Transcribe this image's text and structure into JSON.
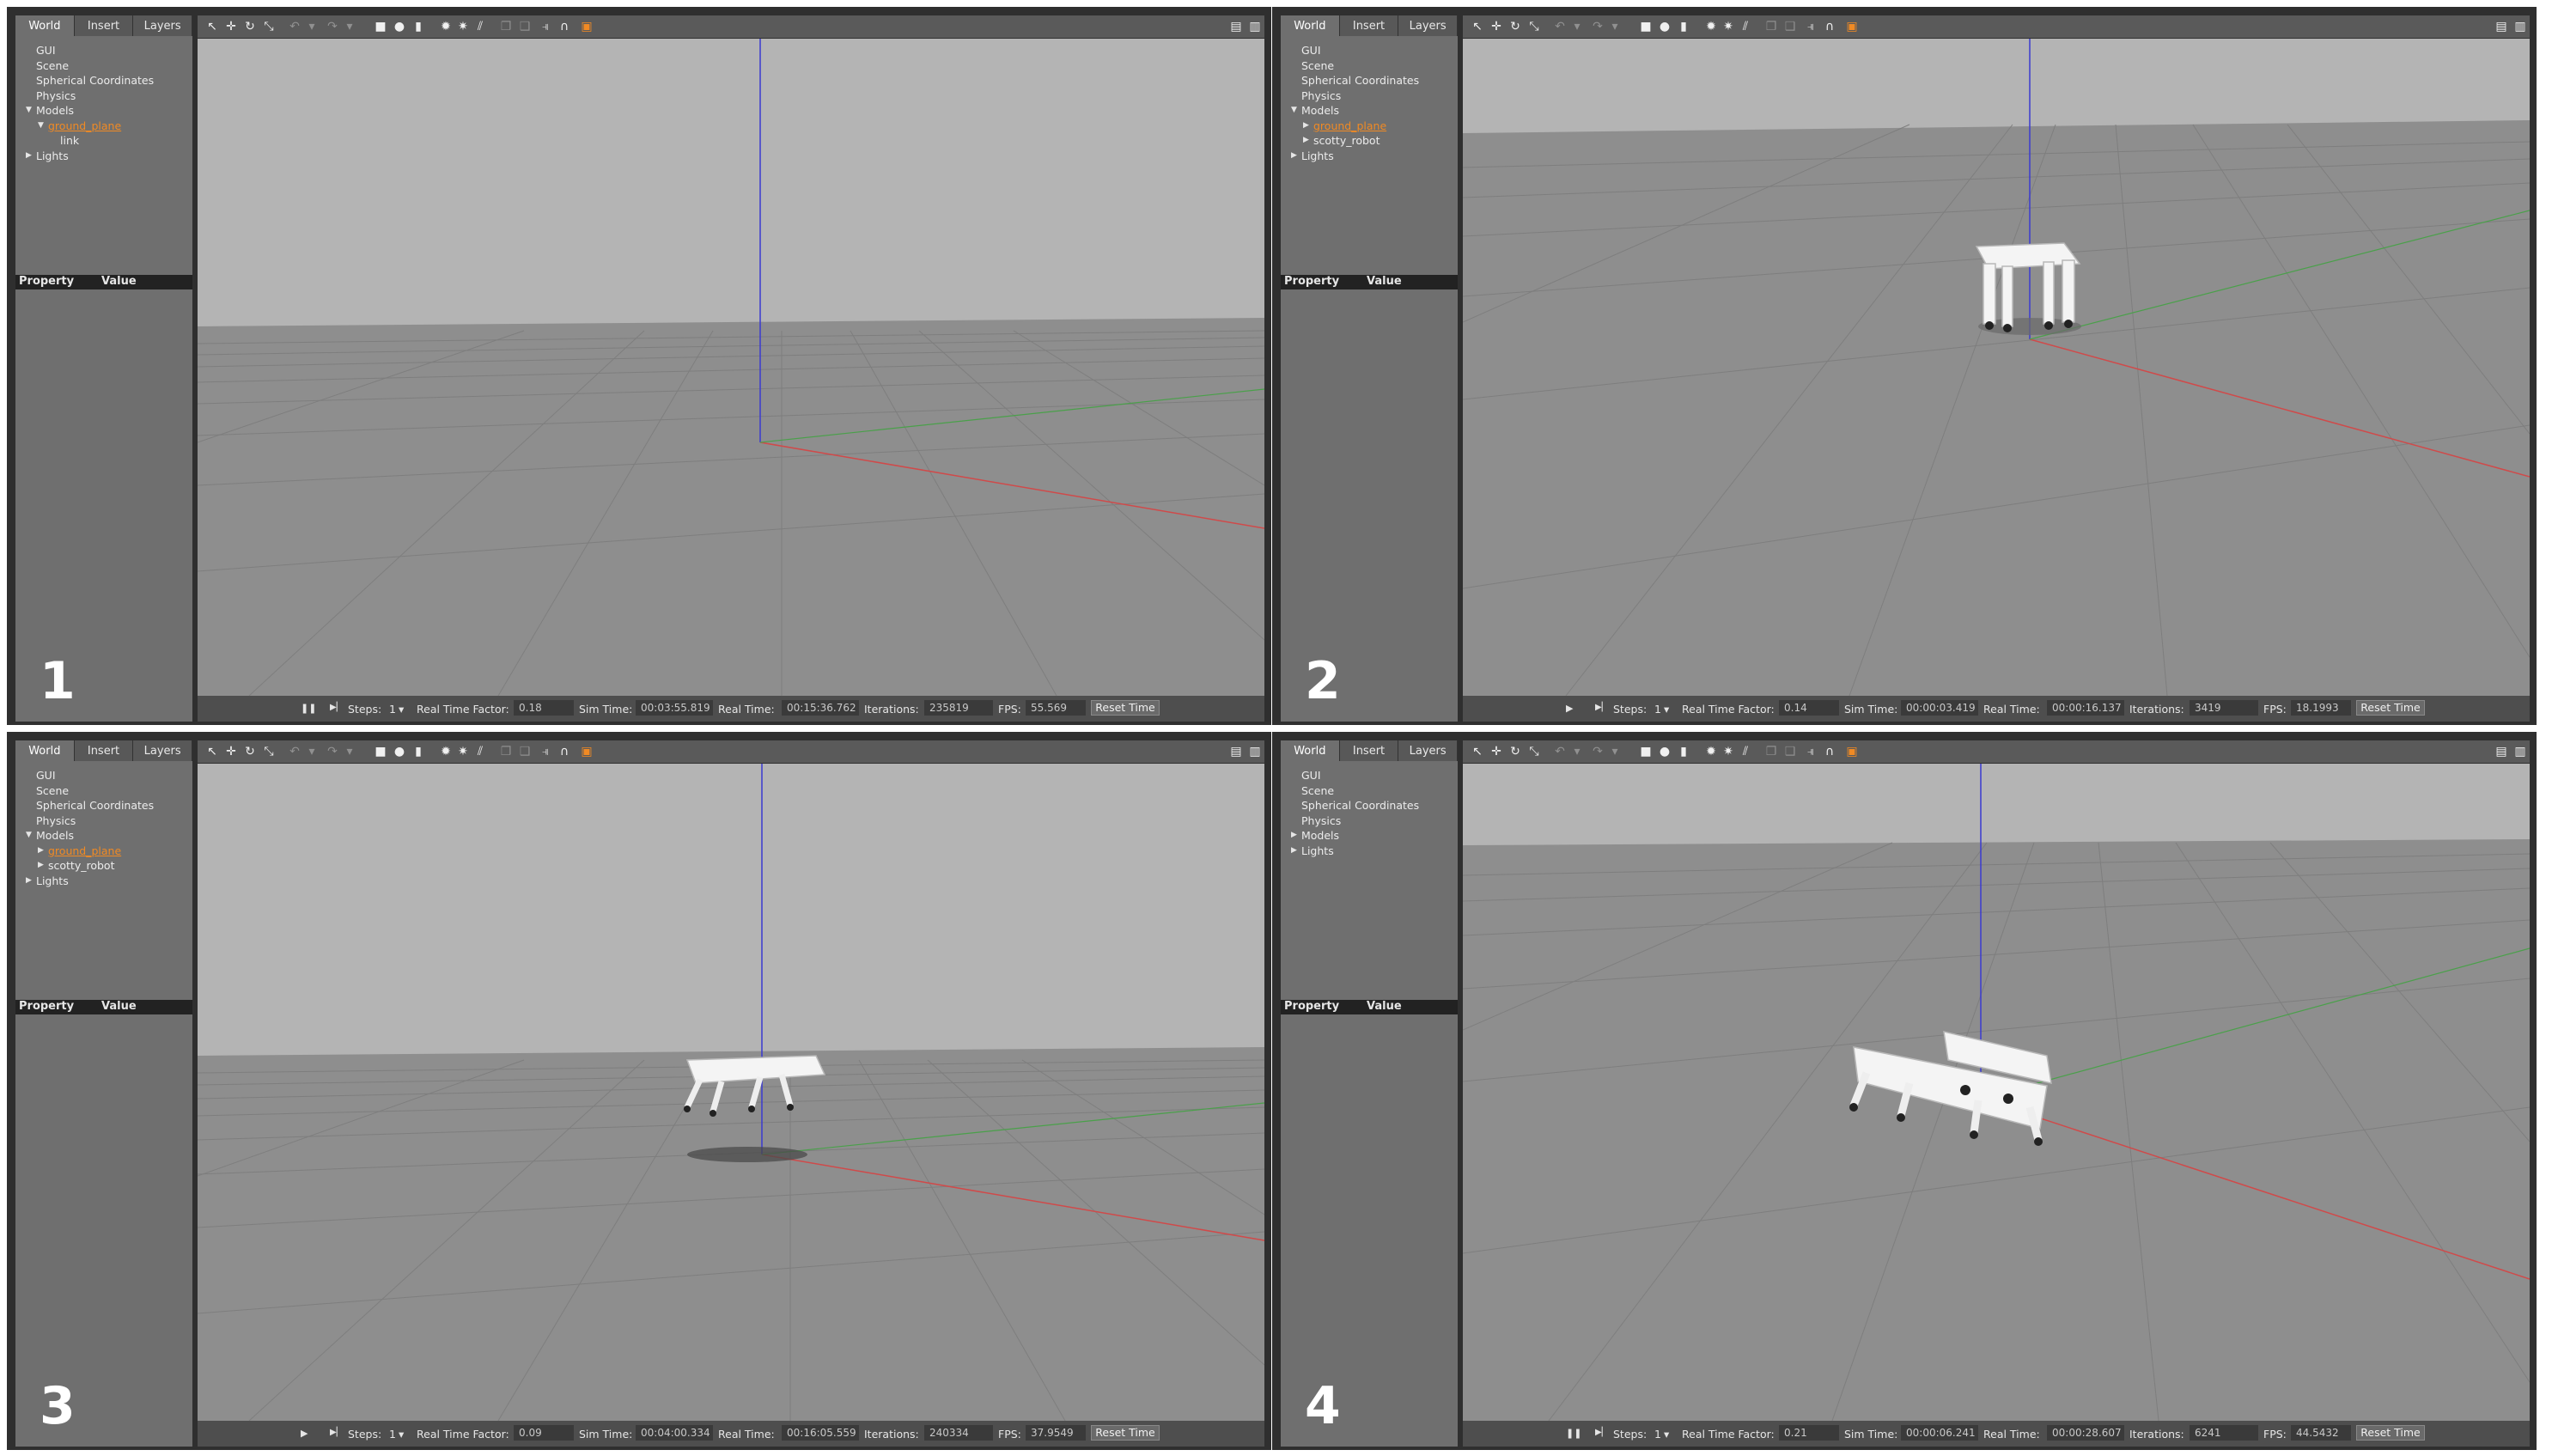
{
  "tabs": [
    "World",
    "Insert",
    "Layers"
  ],
  "property_header": {
    "property": "Property",
    "value": "Value"
  },
  "toolbar_icons": [
    "select-arrow-icon",
    "translate-icon",
    "rotate-icon",
    "scale-icon",
    "undo-icon",
    "undo-dropdown-icon",
    "redo-icon",
    "redo-dropdown-icon",
    "box-icon",
    "sphere-icon",
    "cylinder-icon",
    "point-light-icon",
    "spot-light-icon",
    "directional-light-icon",
    "copy-icon",
    "paste-icon",
    "align-icon",
    "snap-icon",
    "change-view-icon",
    "screenshot-icon",
    "record-icon"
  ],
  "panels": [
    {
      "number": "1",
      "tree": [
        {
          "label": "GUI",
          "indent": 0,
          "arrow": "",
          "highlight": false
        },
        {
          "label": "Scene",
          "indent": 0,
          "arrow": "",
          "highlight": false
        },
        {
          "label": "Spherical Coordinates",
          "indent": 0,
          "arrow": "",
          "highlight": false
        },
        {
          "label": "Physics",
          "indent": 0,
          "arrow": "",
          "highlight": false
        },
        {
          "label": "Models",
          "indent": 0,
          "arrow": "down",
          "highlight": false
        },
        {
          "label": "ground_plane",
          "indent": 1,
          "arrow": "down",
          "highlight": true
        },
        {
          "label": "link",
          "indent": 2,
          "arrow": "",
          "highlight": false
        },
        {
          "label": "Lights",
          "indent": 0,
          "arrow": "right",
          "highlight": false
        }
      ],
      "status": {
        "playing": true,
        "steps_label": "Steps:",
        "steps_value": "1",
        "rtf_label": "Real Time Factor:",
        "rtf_value": "0.18",
        "sim_label": "Sim Time:",
        "sim_value": "00:03:55.819",
        "real_label": "Real Time:",
        "real_value": "00:15:36.762",
        "iter_label": "Iterations:",
        "iter_value": "235819",
        "fps_label": "FPS:",
        "fps_value": "55.569",
        "reset_label": "Reset Time"
      }
    },
    {
      "number": "2",
      "tree": [
        {
          "label": "GUI",
          "indent": 0,
          "arrow": "",
          "highlight": false
        },
        {
          "label": "Scene",
          "indent": 0,
          "arrow": "",
          "highlight": false
        },
        {
          "label": "Spherical Coordinates",
          "indent": 0,
          "arrow": "",
          "highlight": false
        },
        {
          "label": "Physics",
          "indent": 0,
          "arrow": "",
          "highlight": false
        },
        {
          "label": "Models",
          "indent": 0,
          "arrow": "down",
          "highlight": false
        },
        {
          "label": "ground_plane",
          "indent": 1,
          "arrow": "right",
          "highlight": true
        },
        {
          "label": "scotty_robot",
          "indent": 1,
          "arrow": "right",
          "highlight": false
        },
        {
          "label": "Lights",
          "indent": 0,
          "arrow": "right",
          "highlight": false
        }
      ],
      "status": {
        "playing": false,
        "steps_label": "Steps:",
        "steps_value": "1",
        "rtf_label": "Real Time Factor:",
        "rtf_value": "0.14",
        "sim_label": "Sim Time:",
        "sim_value": "00:00:03.419",
        "real_label": "Real Time:",
        "real_value": "00:00:16.137",
        "iter_label": "Iterations:",
        "iter_value": "3419",
        "fps_label": "FPS:",
        "fps_value": "18.1993",
        "reset_label": "Reset Time"
      }
    },
    {
      "number": "3",
      "tree": [
        {
          "label": "GUI",
          "indent": 0,
          "arrow": "",
          "highlight": false
        },
        {
          "label": "Scene",
          "indent": 0,
          "arrow": "",
          "highlight": false
        },
        {
          "label": "Spherical Coordinates",
          "indent": 0,
          "arrow": "",
          "highlight": false
        },
        {
          "label": "Physics",
          "indent": 0,
          "arrow": "",
          "highlight": false
        },
        {
          "label": "Models",
          "indent": 0,
          "arrow": "down",
          "highlight": false
        },
        {
          "label": "ground_plane",
          "indent": 1,
          "arrow": "right",
          "highlight": true
        },
        {
          "label": "scotty_robot",
          "indent": 1,
          "arrow": "right",
          "highlight": false
        },
        {
          "label": "Lights",
          "indent": 0,
          "arrow": "right",
          "highlight": false
        }
      ],
      "status": {
        "playing": false,
        "steps_label": "Steps:",
        "steps_value": "1",
        "rtf_label": "Real Time Factor:",
        "rtf_value": "0.09",
        "sim_label": "Sim Time:",
        "sim_value": "00:04:00.334",
        "real_label": "Real Time:",
        "real_value": "00:16:05.559",
        "iter_label": "Iterations:",
        "iter_value": "240334",
        "fps_label": "FPS:",
        "fps_value": "37.9549",
        "reset_label": "Reset Time"
      }
    },
    {
      "number": "4",
      "tree": [
        {
          "label": "GUI",
          "indent": 0,
          "arrow": "",
          "highlight": false
        },
        {
          "label": "Scene",
          "indent": 0,
          "arrow": "",
          "highlight": false
        },
        {
          "label": "Spherical Coordinates",
          "indent": 0,
          "arrow": "",
          "highlight": false
        },
        {
          "label": "Physics",
          "indent": 0,
          "arrow": "",
          "highlight": false
        },
        {
          "label": "Models",
          "indent": 0,
          "arrow": "right",
          "highlight": false
        },
        {
          "label": "Lights",
          "indent": 0,
          "arrow": "right",
          "highlight": false
        }
      ],
      "status": {
        "playing": true,
        "steps_label": "Steps:",
        "steps_value": "1",
        "rtf_label": "Real Time Factor:",
        "rtf_value": "0.21",
        "sim_label": "Sim Time:",
        "sim_value": "00:00:06.241",
        "real_label": "Real Time:",
        "real_value": "00:00:28.607",
        "iter_label": "Iterations:",
        "iter_value": "6241",
        "fps_label": "FPS:",
        "fps_value": "44.5432",
        "reset_label": "Reset Time"
      }
    }
  ],
  "colors": {
    "sky": "#b4b4b4",
    "ground": "#8e8e8e",
    "grid": "#7c7c7c",
    "axis_x": "#d04a4a",
    "axis_y": "#4aa04a",
    "axis_z": "#3a3ad0",
    "highlight": "#f08a24"
  }
}
